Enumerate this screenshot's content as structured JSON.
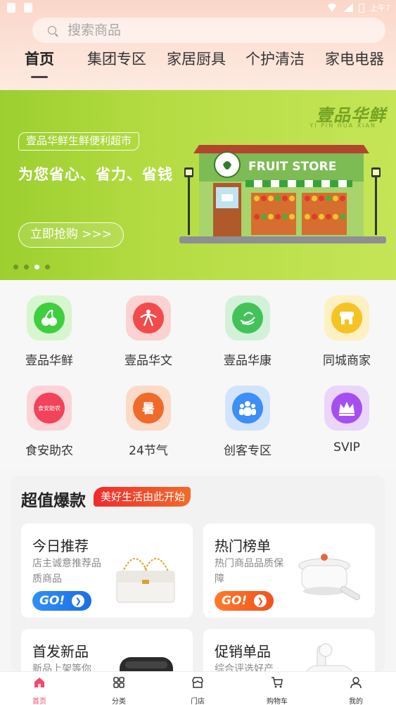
{
  "status_bar": {
    "time": "上午7"
  },
  "search": {
    "placeholder": "搜索商品"
  },
  "tabs": [
    {
      "label": "首页",
      "active": true
    },
    {
      "label": "集团专区",
      "active": false
    },
    {
      "label": "家居厨具",
      "active": false
    },
    {
      "label": "个护清洁",
      "active": false
    },
    {
      "label": "家电电器",
      "active": false
    }
  ],
  "banner": {
    "brand": "壹品华鲜",
    "brand_sub": "YI PIN HUA XIAN",
    "chip": "壹品华鲜生鲜便利超市",
    "headline": "为您省心、省力、省钱",
    "cta": "立即抢购 >>>",
    "store_sign": "FRUIT STORE",
    "slide_count": 4,
    "active_slide": 3,
    "color": "#b5dc43"
  },
  "categories": [
    {
      "label": "壹品华鲜",
      "icon": "cherry-icon",
      "color": "#3ecf3e"
    },
    {
      "label": "壹品华文",
      "icon": "dancer-icon",
      "color": "#f24b4b"
    },
    {
      "label": "壹品华康",
      "icon": "health-leaf-icon",
      "color": "#44c25a"
    },
    {
      "label": "同城商家",
      "icon": "shop-icon",
      "color": "#f5c323"
    },
    {
      "label": "食安助农",
      "icon": "farm-badge-icon",
      "color": "#f2435a",
      "icon_text": "食安助农"
    },
    {
      "label": "24节气",
      "icon": "solar-term-icon",
      "color": "#f06a2a",
      "icon_text": "暑"
    },
    {
      "label": "创客专区",
      "icon": "people-icon",
      "color": "#3d8ef5"
    },
    {
      "label": "SVIP",
      "icon": "crown-icon",
      "color": "#a64ff0"
    }
  ],
  "deals": {
    "title": "超值爆款",
    "tag": "美好生活由此开始",
    "cards": [
      {
        "title": "今日推荐",
        "desc": "店主诚意推荐品质商品",
        "button": "GO!",
        "button_color": "blue",
        "image": "handbag-image"
      },
      {
        "title": "热门榜单",
        "desc": "热门商品品质保障",
        "button": "GO!",
        "button_color": "orange",
        "image": "pot-image"
      },
      {
        "title": "首发新品",
        "desc": "新品上架等你",
        "image": "speaker-image"
      },
      {
        "title": "促销单品",
        "desc": "综合评选好产",
        "image": "earbuds-image"
      }
    ]
  },
  "bottom_nav": [
    {
      "label": "首页",
      "icon": "home-icon",
      "active": true
    },
    {
      "label": "分类",
      "icon": "grid-icon",
      "active": false
    },
    {
      "label": "门店",
      "icon": "store-icon",
      "active": false
    },
    {
      "label": "购物车",
      "icon": "cart-icon",
      "active": false
    },
    {
      "label": "我的",
      "icon": "user-icon",
      "active": false
    }
  ],
  "colors": {
    "accent": "#f24b6d",
    "deal_tag": "#ef2b2b"
  }
}
